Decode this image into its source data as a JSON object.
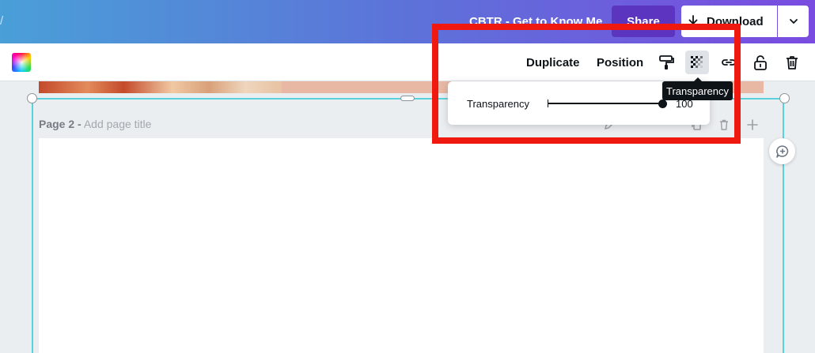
{
  "header": {
    "crumb": "/",
    "doc_title": "CBTR - Get to Know Me",
    "share_label": "Share",
    "download_label": "Download"
  },
  "toolbar": {
    "duplicate_label": "Duplicate",
    "position_label": "Position",
    "icons": [
      "color-swatch",
      "paint-roller-icon",
      "transparency-icon",
      "link-icon",
      "unlock-icon",
      "trash-icon"
    ]
  },
  "page": {
    "label": "Page 2 -",
    "title_placeholder": "Add page title"
  },
  "transparency_popover": {
    "label": "Transparency",
    "value": "100"
  },
  "tooltip": {
    "text": "Transparency"
  },
  "colors": {
    "accent": "#5ad2dc",
    "highlight": "#f0190f",
    "header_gradient_start": "#4a9fd8",
    "header_gradient_end": "#7a4be0"
  }
}
